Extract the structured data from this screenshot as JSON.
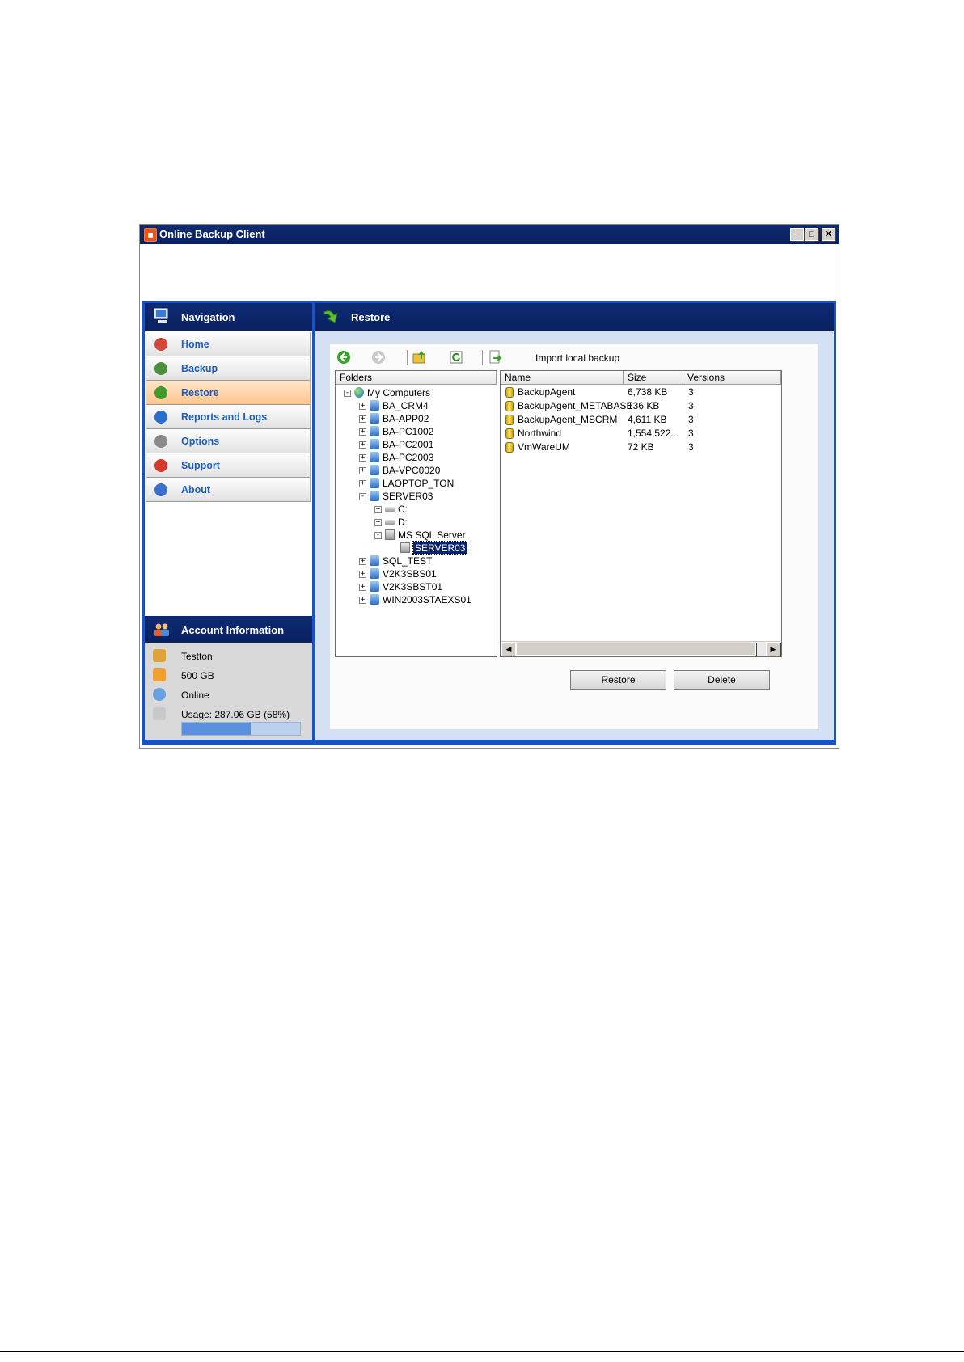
{
  "window": {
    "title": "Online Backup Client",
    "min": "_",
    "max": "□",
    "close": "✕"
  },
  "nav": {
    "header": "Navigation",
    "items": [
      {
        "label": "Home",
        "icon": "home-icon",
        "color": "#d4473b"
      },
      {
        "label": "Backup",
        "icon": "backup-icon",
        "color": "#4a8f3e"
      },
      {
        "label": "Restore",
        "icon": "restore-icon",
        "color": "#3f9b2c"
      },
      {
        "label": "Reports and Logs",
        "icon": "reports-icon",
        "color": "#2a6fd0"
      },
      {
        "label": "Options",
        "icon": "options-icon",
        "color": "#8a8a8a"
      },
      {
        "label": "Support",
        "icon": "support-icon",
        "color": "#d43a2a"
      },
      {
        "label": "About",
        "icon": "about-icon",
        "color": "#3a6fcc"
      }
    ],
    "active": "Restore"
  },
  "account": {
    "header": "Account Information",
    "user": "Testton",
    "quota": "500 GB",
    "status": "Online",
    "usage": "Usage: 287.06 GB (58%)",
    "usage_fraction": 0.58
  },
  "content": {
    "header": "Restore",
    "toolbar": {
      "import_label": "Import local backup"
    },
    "folders_header": "Folders",
    "tree": [
      {
        "label": "My Computers",
        "depth": 0,
        "expander": "−",
        "type": "globe"
      },
      {
        "label": "BA_CRM4",
        "depth": 1,
        "expander": "+",
        "type": "computer"
      },
      {
        "label": "BA-APP02",
        "depth": 1,
        "expander": "+",
        "type": "computer"
      },
      {
        "label": "BA-PC1002",
        "depth": 1,
        "expander": "+",
        "type": "computer"
      },
      {
        "label": "BA-PC2001",
        "depth": 1,
        "expander": "+",
        "type": "computer"
      },
      {
        "label": "BA-PC2003",
        "depth": 1,
        "expander": "+",
        "type": "computer"
      },
      {
        "label": "BA-VPC0020",
        "depth": 1,
        "expander": "+",
        "type": "computer"
      },
      {
        "label": "LAOPTOP_TON",
        "depth": 1,
        "expander": "+",
        "type": "computer"
      },
      {
        "label": "SERVER03",
        "depth": 1,
        "expander": "−",
        "type": "computer"
      },
      {
        "label": "C:",
        "depth": 2,
        "expander": "+",
        "type": "drive"
      },
      {
        "label": "D:",
        "depth": 2,
        "expander": "+",
        "type": "drive"
      },
      {
        "label": "MS SQL Server",
        "depth": 2,
        "expander": "−",
        "type": "sql"
      },
      {
        "label": "SERVER03",
        "depth": 3,
        "expander": "",
        "type": "sql",
        "selected": true
      },
      {
        "label": "SQL_TEST",
        "depth": 1,
        "expander": "+",
        "type": "computer"
      },
      {
        "label": "V2K3SBS01",
        "depth": 1,
        "expander": "+",
        "type": "computer"
      },
      {
        "label": "V2K3SBST01",
        "depth": 1,
        "expander": "+",
        "type": "computer"
      },
      {
        "label": "WIN2003STAEXS01",
        "depth": 1,
        "expander": "+",
        "type": "computer"
      }
    ],
    "columns": [
      "Name",
      "Size",
      "Versions"
    ],
    "files": [
      {
        "name": "BackupAgent",
        "size": "6,738 KB",
        "versions": "3"
      },
      {
        "name": "BackupAgent_METABASE",
        "size": "136 KB",
        "versions": "3"
      },
      {
        "name": "BackupAgent_MSCRM",
        "size": "4,611 KB",
        "versions": "3"
      },
      {
        "name": "Northwind",
        "size": "1,554,522...",
        "versions": "3"
      },
      {
        "name": "VmWareUM",
        "size": "72 KB",
        "versions": "3"
      }
    ],
    "buttons": {
      "restore": "Restore",
      "delete": "Delete"
    }
  }
}
